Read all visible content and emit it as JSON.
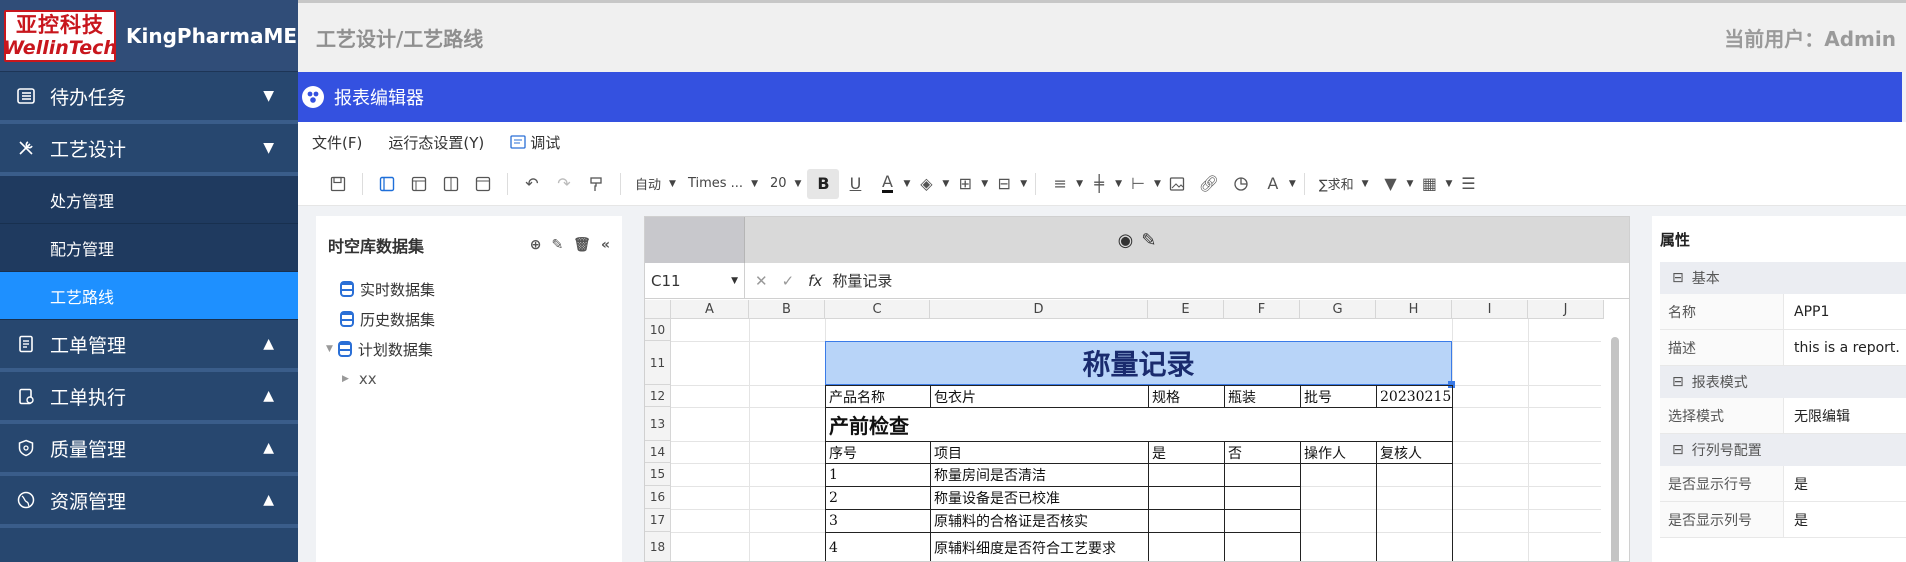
{
  "brand": {
    "logo_cn": "亚控科技",
    "logo_en": "WellinTech",
    "name": "KingPharmaMES"
  },
  "sidebar": {
    "groups": [
      {
        "label": "待办任务",
        "arrow": "▼"
      },
      {
        "label": "工艺设计",
        "arrow": "▼",
        "items": [
          {
            "label": "处方管理"
          },
          {
            "label": "配方管理"
          },
          {
            "label": "工艺路线"
          }
        ]
      },
      {
        "label": "工单管理",
        "arrow": "▲"
      },
      {
        "label": "工单执行",
        "arrow": "▲"
      },
      {
        "label": "质量管理",
        "arrow": "▲"
      },
      {
        "label": "资源管理",
        "arrow": "▲"
      }
    ]
  },
  "header": {
    "breadcrumb": "工艺设计/工艺路线",
    "user": "当前用户：Admin"
  },
  "editor": {
    "title": "报表编辑器"
  },
  "menus": {
    "file": "文件(F)",
    "runtime": "运行态设置(Y)",
    "debug": "调试"
  },
  "toolbar": {
    "zoom": "自动",
    "font": "Times ...",
    "size": "20",
    "bold": "B",
    "underline": "U",
    "fontcolor": "A",
    "sum": "∑求和",
    "textcolor": "A"
  },
  "dataset": {
    "title": "时空库数据集",
    "items": [
      {
        "label": "实时数据集"
      },
      {
        "label": "历史数据集"
      },
      {
        "label": "计划数据集"
      }
    ],
    "child": "xx"
  },
  "sheet": {
    "cell_ref": "C11",
    "fx": "fx",
    "formula": "称量记录",
    "columns": [
      "A",
      "B",
      "C",
      "D",
      "E",
      "F",
      "G",
      "H",
      "I",
      "J"
    ],
    "rows": [
      "10",
      "11",
      "12",
      "13",
      "14",
      "15",
      "16",
      "17",
      "18"
    ],
    "title": "称量记录",
    "r12": {
      "c": "产品名称",
      "d": "包衣片",
      "e": "规格",
      "f": "瓶装",
      "g": "批号",
      "h": "20230215"
    },
    "r13": "产前检查",
    "r14": {
      "c": "序号",
      "d": "项目",
      "e": "是",
      "f": "否",
      "g": "操作人",
      "h": "复核人"
    },
    "r15": {
      "c": "1",
      "d": "称量房间是否清洁"
    },
    "r16": {
      "c": "2",
      "d": "称量设备是否已校准"
    },
    "r17": {
      "c": "3",
      "d": "原辅料的合格证是否核实"
    },
    "r18": {
      "c": "4",
      "d": "原辅料细度是否符合工艺要求"
    }
  },
  "props": {
    "title": "属性",
    "sections": [
      {
        "label": "基本",
        "rows": [
          {
            "k": "名称",
            "v": "APP1"
          },
          {
            "k": "描述",
            "v": "this is a report."
          }
        ]
      },
      {
        "label": "报表模式",
        "rows": [
          {
            "k": "选择模式",
            "v": "无限编辑"
          }
        ]
      },
      {
        "label": "行列号配置",
        "rows": [
          {
            "k": "是否显示行号",
            "v": "是"
          },
          {
            "k": "是否显示列号",
            "v": "是"
          }
        ]
      }
    ]
  }
}
